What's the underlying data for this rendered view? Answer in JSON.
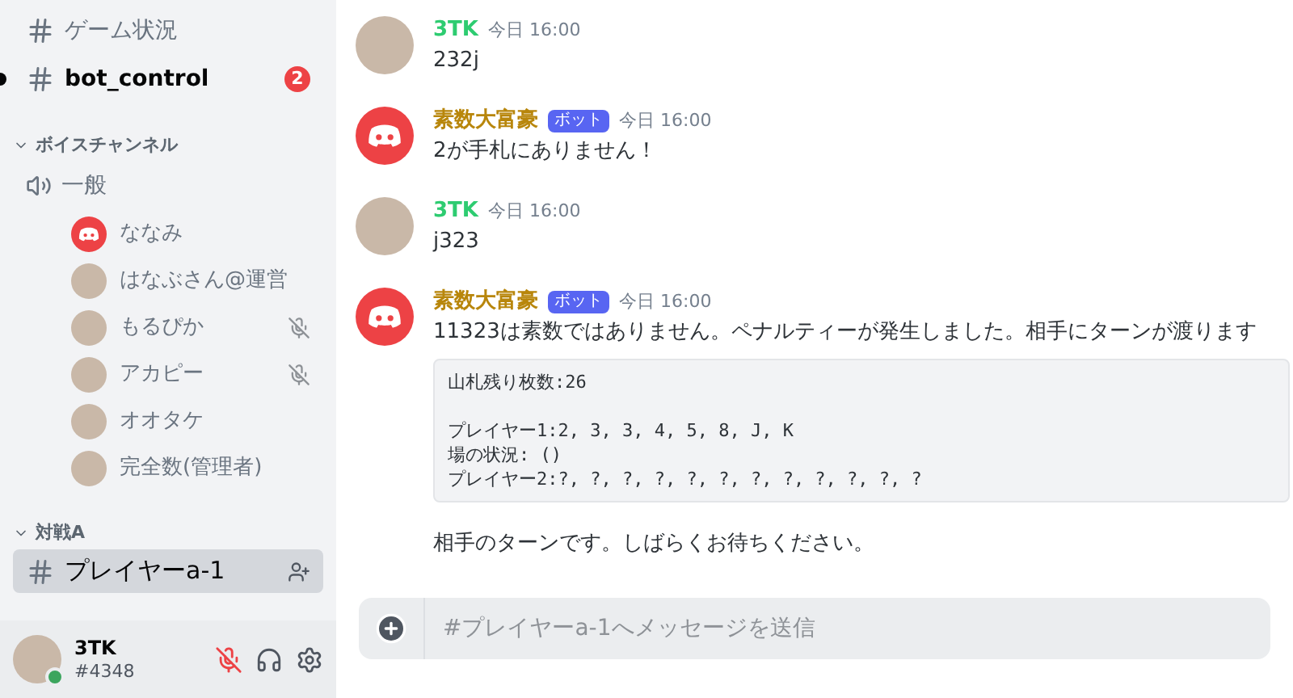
{
  "sidebar": {
    "text_channels": [
      {
        "name": "ゲーム状況",
        "unread": false
      },
      {
        "name": "bot_control",
        "unread": true,
        "badge": "2"
      }
    ],
    "voice_category": {
      "label": "ボイスチャンネル",
      "expanded": true
    },
    "voice_channel": {
      "name": "一般",
      "users": [
        {
          "name": "ななみ",
          "kind": "default",
          "muted": false
        },
        {
          "name": "はなぶさん@運営",
          "kind": "image",
          "muted": false
        },
        {
          "name": "もるぴか",
          "kind": "image",
          "muted": true
        },
        {
          "name": "アカピー",
          "kind": "image",
          "muted": true
        },
        {
          "name": "オオタケ",
          "kind": "image",
          "muted": false
        },
        {
          "name": "完全数(管理者)",
          "kind": "image",
          "muted": false
        }
      ]
    },
    "match_category": {
      "label": "対戦A",
      "expanded": true,
      "channels": [
        {
          "name": "プレイヤーa-1",
          "selected": true
        }
      ]
    },
    "user_panel": {
      "name": "3TK",
      "tag": "#4348",
      "mic_muted": true
    }
  },
  "messages": [
    {
      "author": "3TK",
      "kind": "user",
      "time": "今日 16:00",
      "lines": [
        "232j"
      ]
    },
    {
      "author": "素数大富豪",
      "kind": "bot",
      "bot_tag": "ボット",
      "time": "今日 16:00",
      "lines": [
        "2が手札にありません！"
      ]
    },
    {
      "author": "3TK",
      "kind": "user",
      "time": "今日 16:00",
      "lines": [
        "j323"
      ]
    },
    {
      "author": "素数大富豪",
      "kind": "bot",
      "bot_tag": "ボット",
      "time": "今日 16:00",
      "lines": [
        "11323は素数ではありません。ペナルティーが発生しました。相手にターンが渡ります"
      ],
      "code": [
        [
          "山札残り枚数:26"
        ],
        [
          "プレイヤー1:2, 3, 3, 4, 5, 8, J, K",
          "場の状況: ()",
          "プレイヤー2:?, ?, ?, ?, ?, ?, ?, ?, ?, ?, ?, ?"
        ]
      ],
      "after": "相手のターンです。しばらくお待ちください。"
    }
  ],
  "composer": {
    "placeholder": "#プレイヤーa-1へメッセージを送信"
  }
}
